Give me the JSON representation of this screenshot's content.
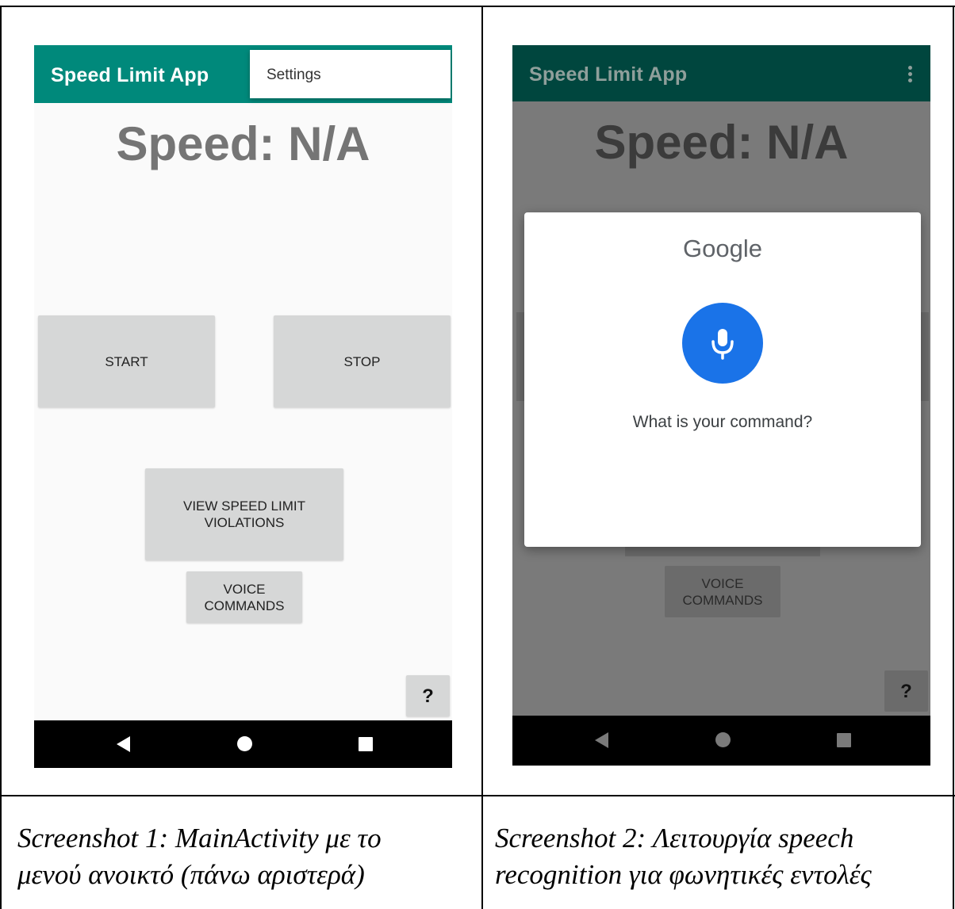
{
  "screens": [
    {
      "app_title": "Speed Limit App",
      "overflow_menu": {
        "items": [
          "Settings"
        ]
      },
      "speed_text": "Speed: N/A",
      "buttons": {
        "start": "START",
        "stop": "STOP",
        "violations_line1": "VIEW SPEED LIMIT",
        "violations_line2": "VIOLATIONS",
        "voice_line1": "VOICE",
        "voice_line2": "COMMANDS",
        "help": "?"
      }
    },
    {
      "app_title": "Speed Limit App",
      "speed_text": "Speed: N/A",
      "dialog": {
        "brand": "Google",
        "prompt": "What is your command?"
      },
      "buttons": {
        "voice_line1": "VOICE",
        "voice_line2": "COMMANDS",
        "help": "?"
      }
    }
  ],
  "captions": [
    {
      "line1": "Screenshot 1: MainActivity με το",
      "line2": "μενού ανοικτό (πάνω αριστερά)"
    },
    {
      "line1": "Screenshot 2: Λειτουργία speech",
      "line2": "recognition για φωνητικές εντολές"
    }
  ],
  "colors": {
    "appbar": "#00897b",
    "appbar_dimmed": "#00463e",
    "button_bg": "#d6d7d7",
    "button_dimmed": "#6b6b6b",
    "mic_blue": "#1a73e8",
    "speed_text": "#757575",
    "speed_text_dimmed": "#3b3b3b"
  }
}
